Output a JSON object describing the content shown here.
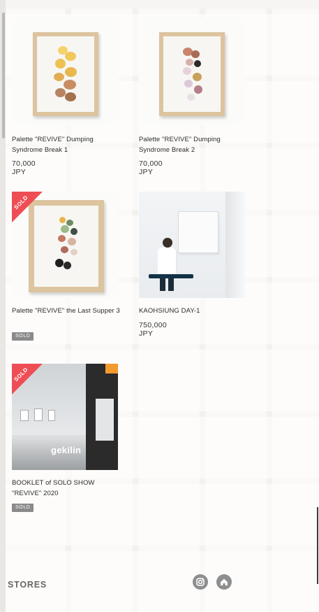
{
  "products": [
    {
      "title": "Palette \"REVIVE\" Dumping Syndrome Break 1",
      "price": "70,000 JPY"
    },
    {
      "title": "Palette \"REVIVE\" Dumping Syndrome Break 2",
      "price": "70,000 JPY"
    },
    {
      "title": "Palette \"REVIVE\" the Last Supper 3",
      "badge": "SOLD",
      "status": "SOLD OUT"
    },
    {
      "title": "KAOHSIUNG DAY-1",
      "price": "750,000 JPY"
    },
    {
      "title": "BOOKLET of SOLO SHOW \"REVIVE\" 2020",
      "badge": "SOLD",
      "status": "SOLD OUT",
      "image_text": "gekilin"
    }
  ],
  "footer": {
    "stores_label": "STORES",
    "icons": [
      "instagram-icon",
      "home-icon"
    ]
  },
  "colors": {
    "sold_ribbon": "#ef4d55",
    "sold_out_badge": "#8a8a8a"
  }
}
